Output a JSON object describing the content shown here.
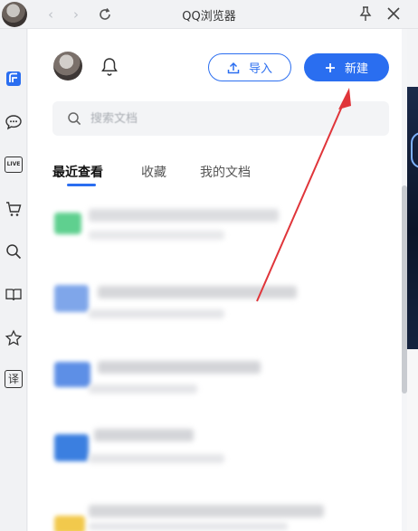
{
  "titlebar": {
    "title": "QQ浏览器",
    "back_icon": "‹",
    "forward_icon": "›"
  },
  "sidebar_icons": [
    "docs-icon",
    "chat-icon",
    "live-icon",
    "cart-icon",
    "search-icon",
    "book-icon",
    "star-icon",
    "translate-icon"
  ],
  "sidebar": {
    "live_label": "LIVE",
    "translate_label": "译"
  },
  "header": {
    "import_label": "导入",
    "new_label": "新建"
  },
  "search": {
    "placeholder": "搜索文档"
  },
  "tabs": [
    {
      "label": "最近查看",
      "active": true
    },
    {
      "label": "收藏",
      "active": false
    },
    {
      "label": "我的文档",
      "active": false
    }
  ],
  "colors": {
    "accent": "#2a6ef0",
    "annotation": "#e0353a"
  }
}
